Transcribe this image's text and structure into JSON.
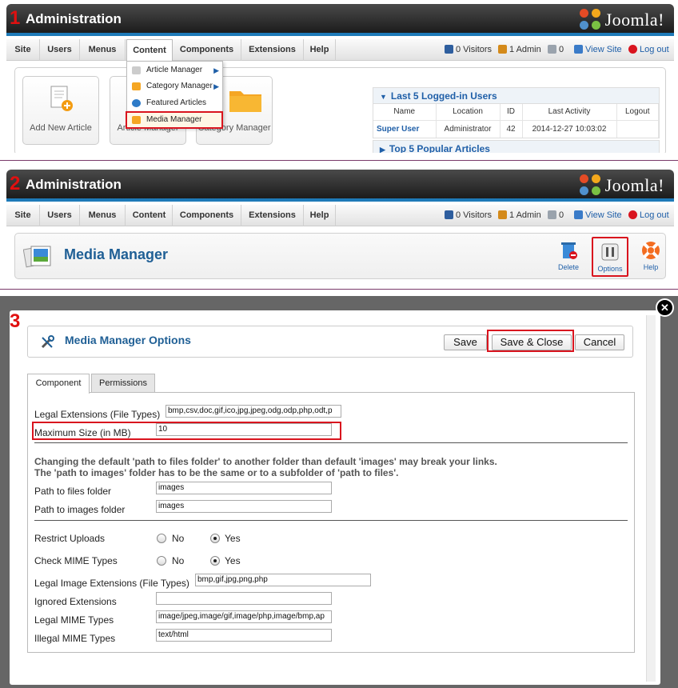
{
  "steps": {
    "one": "1",
    "two": "2",
    "three": "3"
  },
  "header": {
    "title": "Administration",
    "logo_text": "Joomla!"
  },
  "menu": {
    "items": [
      "Site",
      "Users",
      "Menus",
      "Content",
      "Components",
      "Extensions",
      "Help"
    ],
    "visitors": "0 Visitors",
    "admins": "1 Admin",
    "messages": "0",
    "view_site": "View Site",
    "logout": "Log out"
  },
  "content_menu": {
    "items": [
      "Article Manager",
      "Category Manager",
      "Featured Articles",
      "Media Manager"
    ]
  },
  "quick_icons": {
    "add_article": "Add New Article",
    "article_manager": "Article Manager",
    "category_manager": "Category Manager"
  },
  "logged_users": {
    "title": "Last 5 Logged-in Users",
    "columns": [
      "Name",
      "Location",
      "ID",
      "Last Activity",
      "Logout"
    ],
    "rows": [
      {
        "name": "Super User",
        "location": "Administrator",
        "id": "42",
        "last_activity": "2014-12-27 10:03:02",
        "logout": ""
      }
    ]
  },
  "popular": {
    "title": "Top 5 Popular Articles"
  },
  "media_manager": {
    "title": "Media Manager",
    "toolbar": {
      "delete": "Delete",
      "options": "Options",
      "help": "Help"
    }
  },
  "options_dialog": {
    "title": "Media Manager Options",
    "buttons": {
      "save": "Save",
      "save_close": "Save & Close",
      "cancel": "Cancel"
    },
    "tabs": [
      "Component",
      "Permissions"
    ],
    "fields": {
      "legal_extensions": {
        "label": "Legal Extensions (File Types)",
        "value": "bmp,csv,doc,gif,ico,jpg,jpeg,odg,odp,php,odt,p"
      },
      "max_size": {
        "label": "Maximum Size (in MB)",
        "value": "10"
      },
      "path_note_1": "Changing the default 'path to files folder' to another folder than default 'images' may break your links.",
      "path_note_2": "The 'path to images' folder has to be the same or to a subfolder of 'path to files'.",
      "path_files": {
        "label": "Path to files folder",
        "value": "images"
      },
      "path_images": {
        "label": "Path to images folder",
        "value": "images"
      },
      "restrict_uploads": {
        "label": "Restrict Uploads",
        "no": "No",
        "yes": "Yes",
        "selected": "Yes"
      },
      "check_mime": {
        "label": "Check MIME Types",
        "no": "No",
        "yes": "Yes",
        "selected": "Yes"
      },
      "legal_image_ext": {
        "label": "Legal Image Extensions (File Types)",
        "value": "bmp,gif,jpg,png,php"
      },
      "ignored_ext": {
        "label": "Ignored Extensions",
        "value": ""
      },
      "legal_mime": {
        "label": "Legal MIME Types",
        "value": "image/jpeg,image/gif,image/php,image/bmp,ap"
      },
      "illegal_mime": {
        "label": "Illegal MIME Types",
        "value": "text/html"
      }
    }
  },
  "colors": {
    "accent": "#1f5fa8",
    "highlight": "#d9141e",
    "header_bg": "#2a2a2a"
  }
}
